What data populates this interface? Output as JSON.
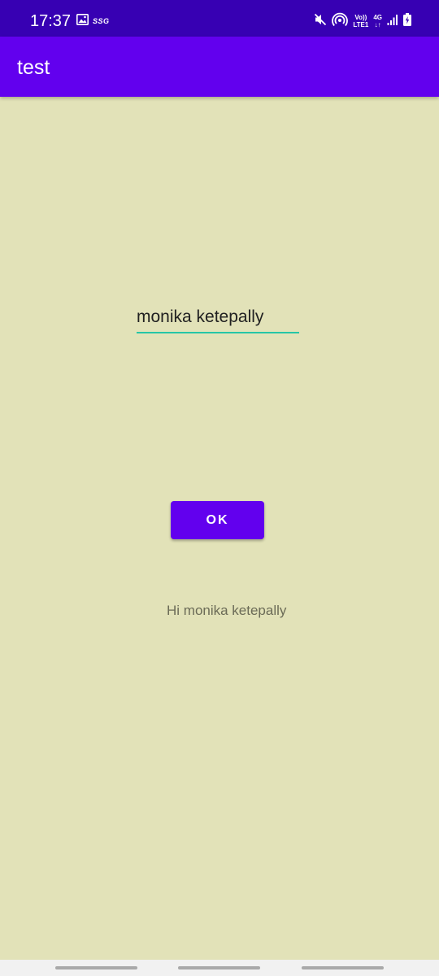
{
  "status_bar": {
    "time": "17:37",
    "carrier_tag": "SSG",
    "volte_line1": "Vo))",
    "volte_line2": "LTE1",
    "network_type": "4G",
    "icons": [
      "gallery-icon",
      "mute-icon",
      "hotspot-icon",
      "signal-icon",
      "battery-charging-icon"
    ],
    "background": "#3700b3"
  },
  "app_bar": {
    "title": "test",
    "background": "#6200ee"
  },
  "form": {
    "name_value": "monika ketepally",
    "underline_color": "#26c6a6",
    "button_label": "OK",
    "button_color": "#6200ee"
  },
  "output": {
    "greeting": "Hi monika ketepally"
  },
  "screen": {
    "background": "#e2e2b8"
  }
}
